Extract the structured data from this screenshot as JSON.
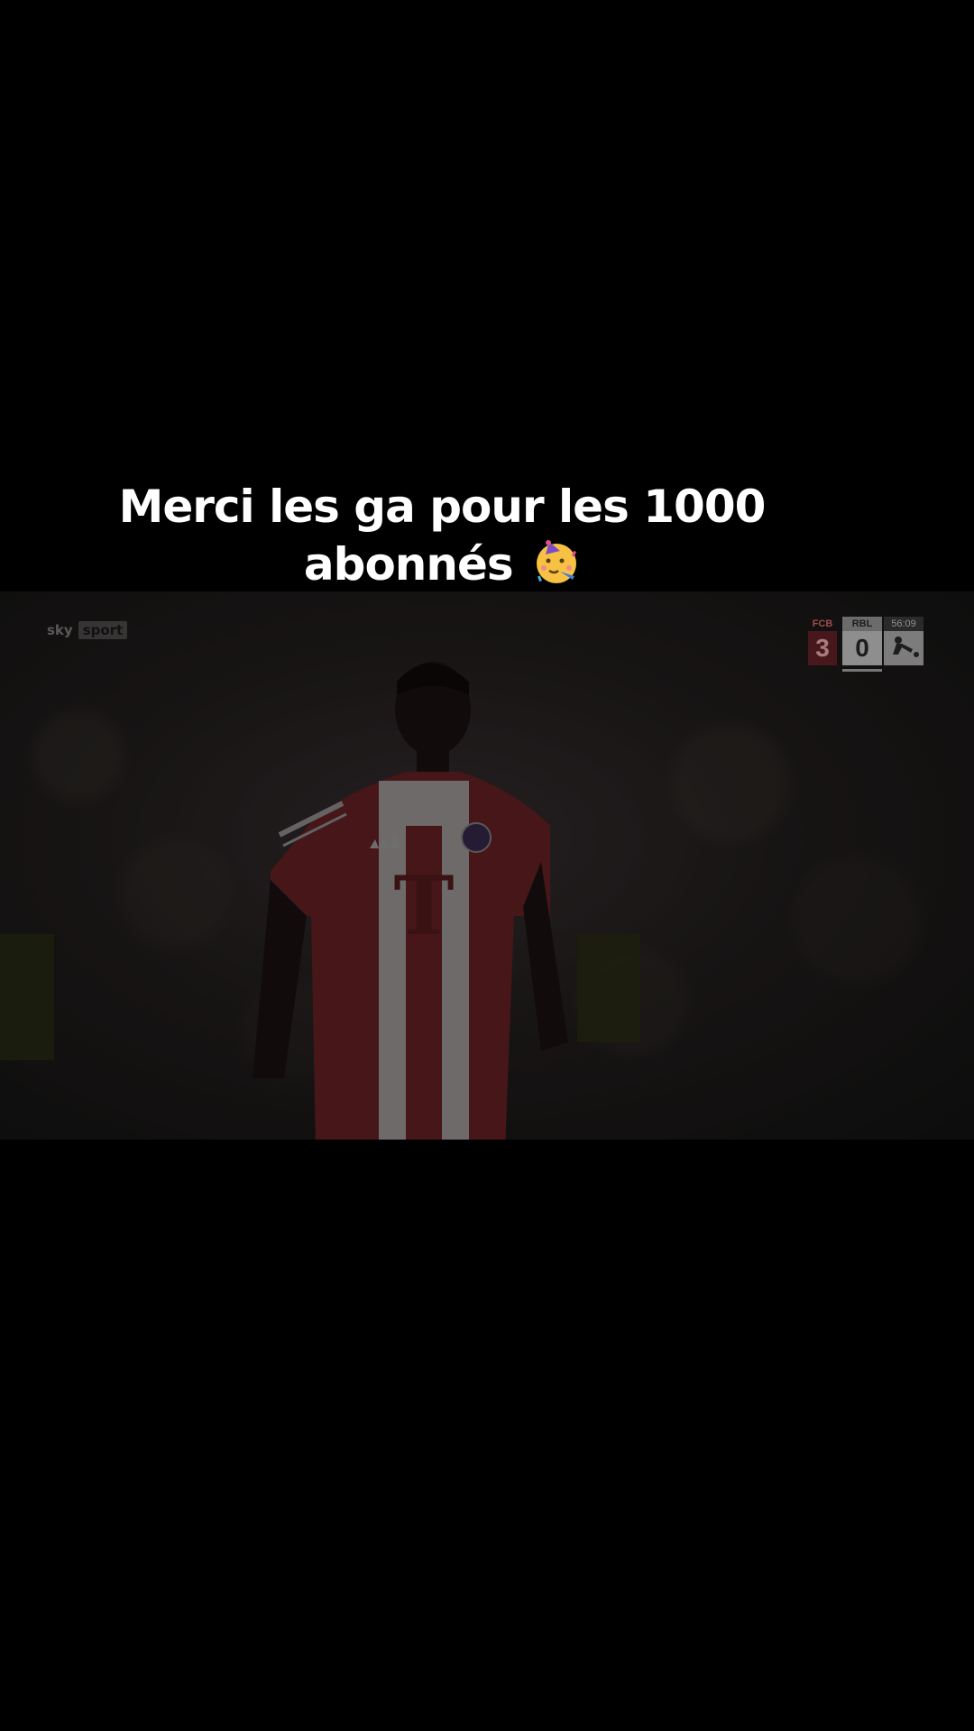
{
  "caption": {
    "line1": "Merci  les ga pour les 1000",
    "line2": "abonnés",
    "emoji_icon": "partying-face-icon"
  },
  "video": {
    "broadcaster": {
      "brand": "sky",
      "channel": "sport"
    },
    "scoreboard": {
      "home_team": "FCB",
      "home_score": "3",
      "away_team": "RBL",
      "away_score": "0",
      "clock": "56:09",
      "league_icon": "bundesliga-logo-icon"
    },
    "jersey_sponsor": "T"
  },
  "colors": {
    "background": "#000000",
    "caption_text": "#ffffff",
    "jersey_red": "#6e2226",
    "jersey_white": "#a9a4a4"
  }
}
